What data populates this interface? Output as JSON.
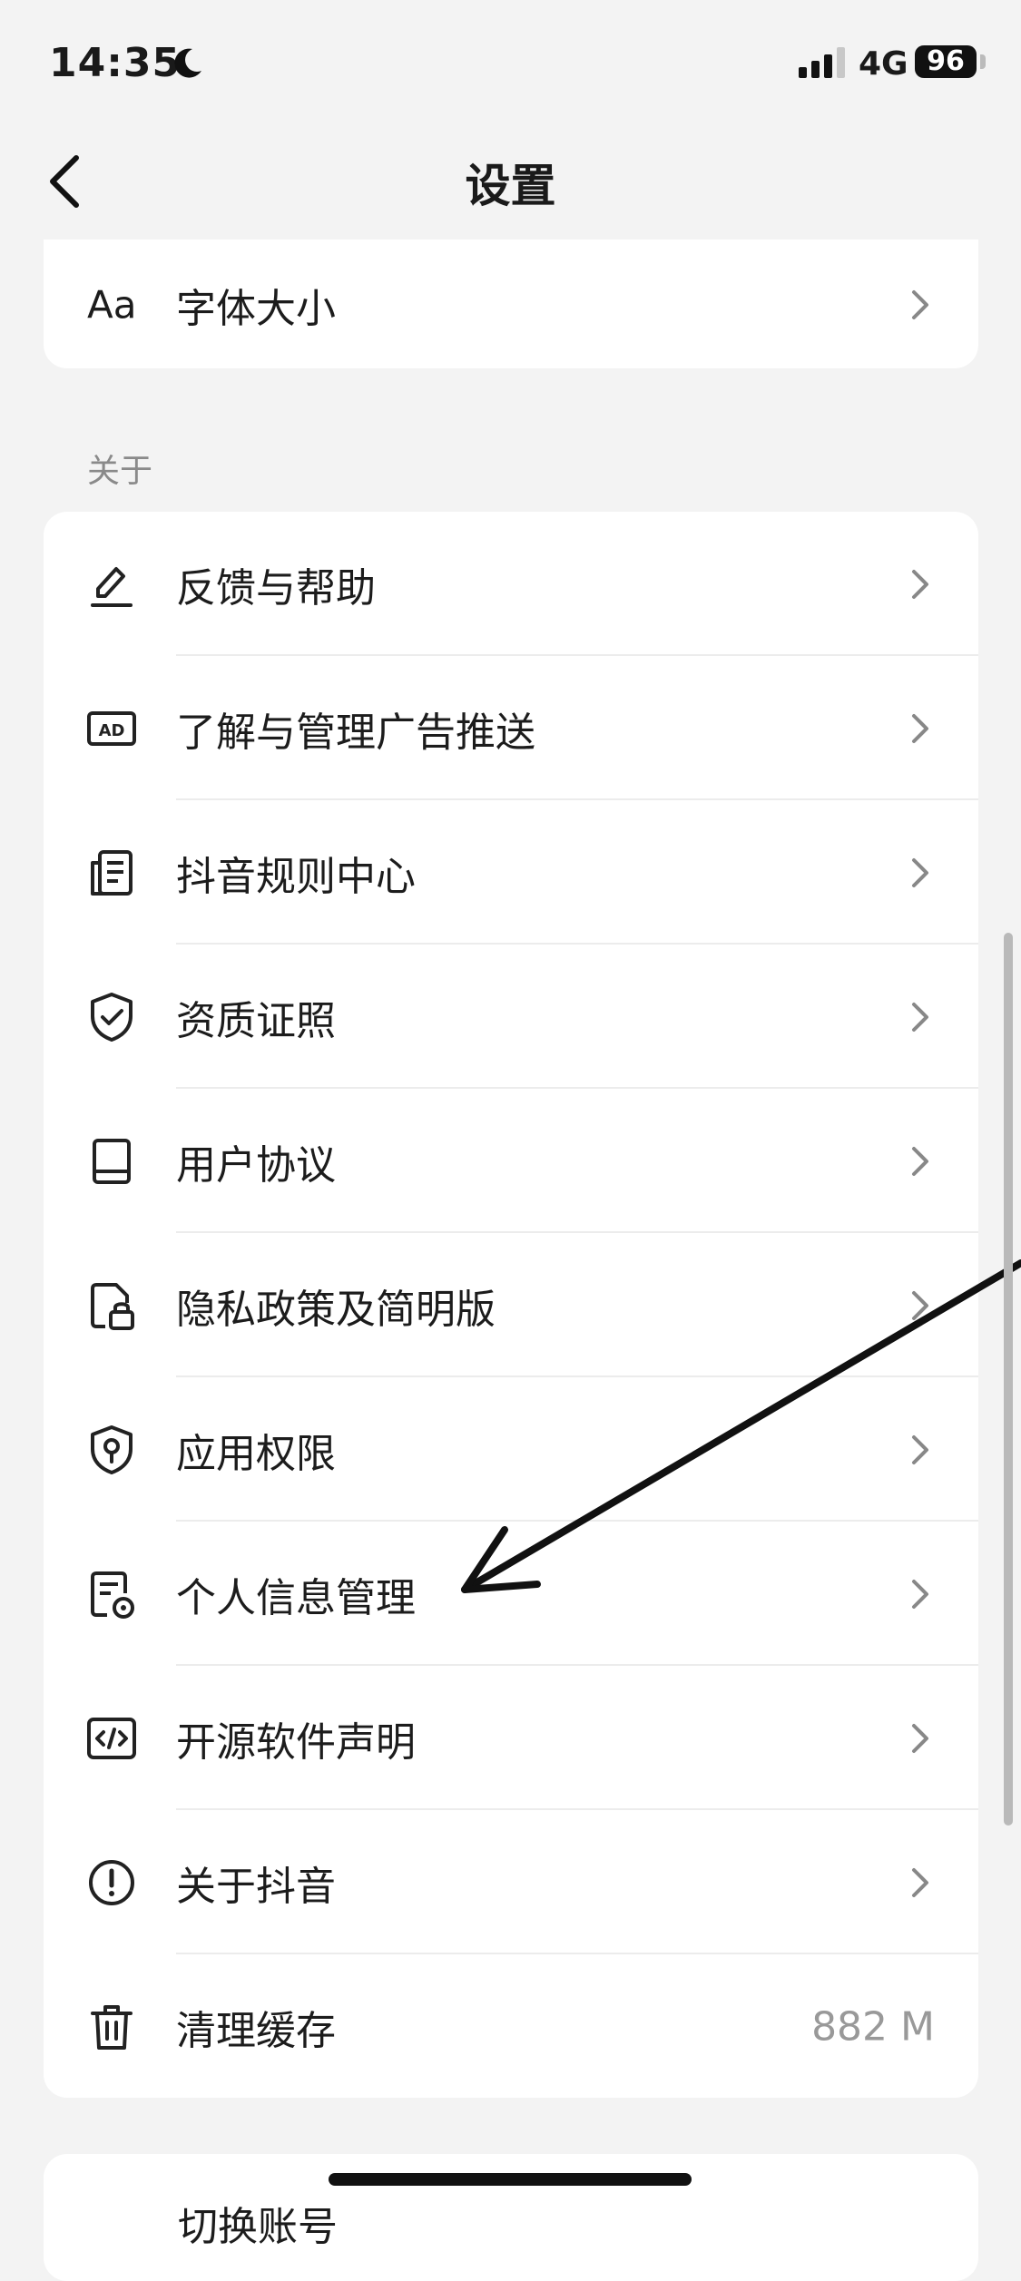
{
  "status_bar": {
    "time": "14:35",
    "network": "4G",
    "battery": "96"
  },
  "header": {
    "title": "设置"
  },
  "display_card": {
    "font_size": {
      "icon_text": "Aa",
      "label": "字体大小"
    }
  },
  "about_section": {
    "label": "关于",
    "items": [
      {
        "label": "反馈与帮助",
        "icon": "pencil-icon"
      },
      {
        "label": "了解与管理广告推送",
        "icon": "ad-icon"
      },
      {
        "label": "抖音规则中心",
        "icon": "document-list-icon"
      },
      {
        "label": "资质证照",
        "icon": "shield-check-icon"
      },
      {
        "label": "用户协议",
        "icon": "book-icon"
      },
      {
        "label": "隐私政策及简明版",
        "icon": "file-lock-icon"
      },
      {
        "label": "应用权限",
        "icon": "shield-key-icon"
      },
      {
        "label": "个人信息管理",
        "icon": "file-settings-icon"
      },
      {
        "label": "开源软件声明",
        "icon": "code-icon"
      },
      {
        "label": "关于抖音",
        "icon": "info-icon"
      },
      {
        "label": "清理缓存",
        "icon": "trash-icon",
        "value": "882 M"
      }
    ]
  },
  "bottom_card": {
    "label": "切换账号"
  },
  "colors": {
    "background": "#f3f3f3",
    "card": "#ffffff",
    "text": "#1c1c1c",
    "secondary": "#999999"
  }
}
